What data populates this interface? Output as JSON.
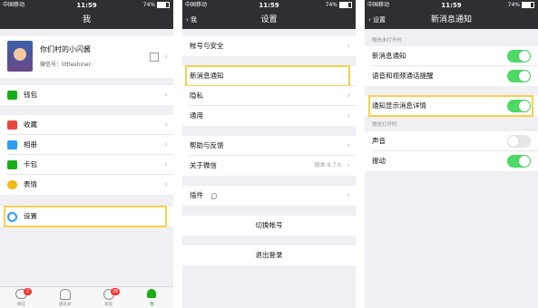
{
  "status": {
    "carrier": "中国移动",
    "time": "11:59",
    "battery": "74%",
    "battery_level": 0.74
  },
  "screen1": {
    "title": "我",
    "profile": {
      "name": "你们村的小闪酱",
      "id_label": "微信号：littleshiner"
    },
    "items": [
      {
        "label": "钱包",
        "icon": "wallet-icon",
        "color": "#1aad19"
      },
      {
        "label": "收藏",
        "icon": "favorites-icon",
        "color": "#e9483f"
      },
      {
        "label": "相册",
        "icon": "album-icon",
        "color": "#2b9bf4"
      },
      {
        "label": "卡包",
        "icon": "card-icon",
        "color": "#1aad19"
      },
      {
        "label": "表情",
        "icon": "sticker-icon",
        "color": "#f5b715"
      },
      {
        "label": "设置",
        "icon": "settings-icon",
        "color": "#2b9bf4"
      }
    ],
    "tabs": [
      {
        "label": "微信",
        "badge": "2",
        "icon": "chat-icon"
      },
      {
        "label": "通讯录",
        "badge": "",
        "icon": "contacts-icon"
      },
      {
        "label": "发现",
        "badge": "26",
        "icon": "discover-icon"
      },
      {
        "label": "我",
        "badge": "",
        "icon": "me-icon"
      }
    ]
  },
  "screen2": {
    "back_label": "我",
    "title": "设置",
    "items": {
      "account_security": "帐号与安全",
      "new_message_notify": "新消息通知",
      "privacy": "隐私",
      "general": "通用",
      "help_feedback": "帮助与反馈",
      "about": "关于微信",
      "about_version": "版本 6.7.0",
      "plugins": "插件"
    },
    "switch_account": "切换帐号",
    "logout": "退出登录"
  },
  "screen3": {
    "back_label": "设置",
    "title": "新消息通知",
    "section_closed": "微信未打开时",
    "section_open": "微信打开时",
    "toggles": [
      {
        "label": "新消息通知",
        "on": true
      },
      {
        "label": "语音和视频通话提醒",
        "on": true
      },
      {
        "label": "通知显示消息详情",
        "on": true
      },
      {
        "label": "声音",
        "on": false
      },
      {
        "label": "振动",
        "on": true
      }
    ]
  },
  "colors": {
    "accent_green": "#4cd964",
    "highlight": "#f7d24a",
    "navbar": "#2e2e33",
    "badge": "#f43530"
  }
}
